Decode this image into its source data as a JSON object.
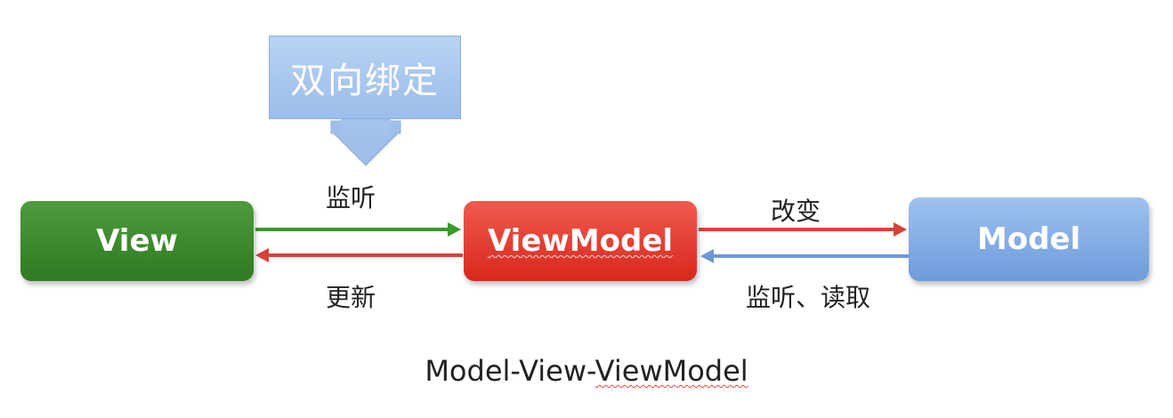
{
  "callout": {
    "text": "双向绑定",
    "color": "#9bbde9"
  },
  "nodes": {
    "view": {
      "label": "View",
      "color": "#3a8a2c"
    },
    "viewmodel": {
      "label": "ViewModel",
      "color": "#e0352a"
    },
    "model": {
      "label": "Model",
      "color": "#7fa8e0"
    }
  },
  "edges": {
    "view_to_viewmodel": {
      "label": "监听",
      "color": "#3a9a2a"
    },
    "viewmodel_to_view": {
      "label": "更新",
      "color": "#d94038"
    },
    "viewmodel_to_model": {
      "label": "改变",
      "color": "#d94038"
    },
    "model_to_viewmodel": {
      "label": "监听、读取",
      "color": "#6f97d6"
    }
  },
  "caption": {
    "prefix": "Model-View-",
    "suffix": "ViewModel"
  }
}
